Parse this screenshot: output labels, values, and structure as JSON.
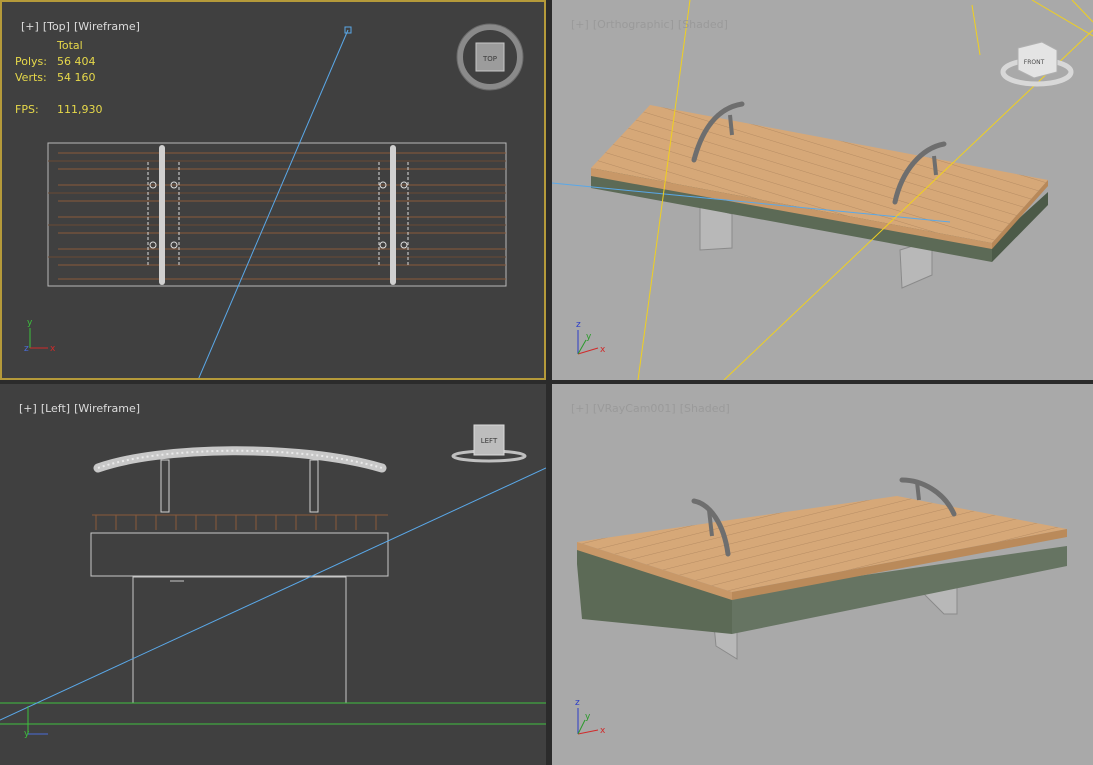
{
  "viewports": {
    "top": {
      "labels": [
        "[+]",
        "[Top]",
        "[Wireframe]"
      ],
      "stats": {
        "header": "Total",
        "polys_label": "Polys:",
        "polys_value": "56 404",
        "verts_label": "Verts:",
        "verts_value": "54 160",
        "fps_label": "FPS:",
        "fps_value": "111,930"
      },
      "viewcube_label": "TOP"
    },
    "perspective": {
      "labels": [
        "[+]",
        "[Orthographic]",
        "[Shaded]"
      ],
      "viewcube_label": "FRONT"
    },
    "left": {
      "labels": [
        "[+]",
        "[Left]",
        "[Wireframe]"
      ],
      "viewcube_label": "LEFT"
    },
    "camera": {
      "labels": [
        "[+]",
        "[VRayCam001]",
        "[Shaded]"
      ]
    }
  },
  "axis": {
    "x": "x",
    "y": "y",
    "z": "z"
  },
  "colors": {
    "active_border": "#b59a3a",
    "wood": "#d8aa78",
    "concrete": "#5c6a56",
    "camera_line": "#5aa8e8",
    "light_line": "#f0d020",
    "ground_line": "#40c040"
  }
}
